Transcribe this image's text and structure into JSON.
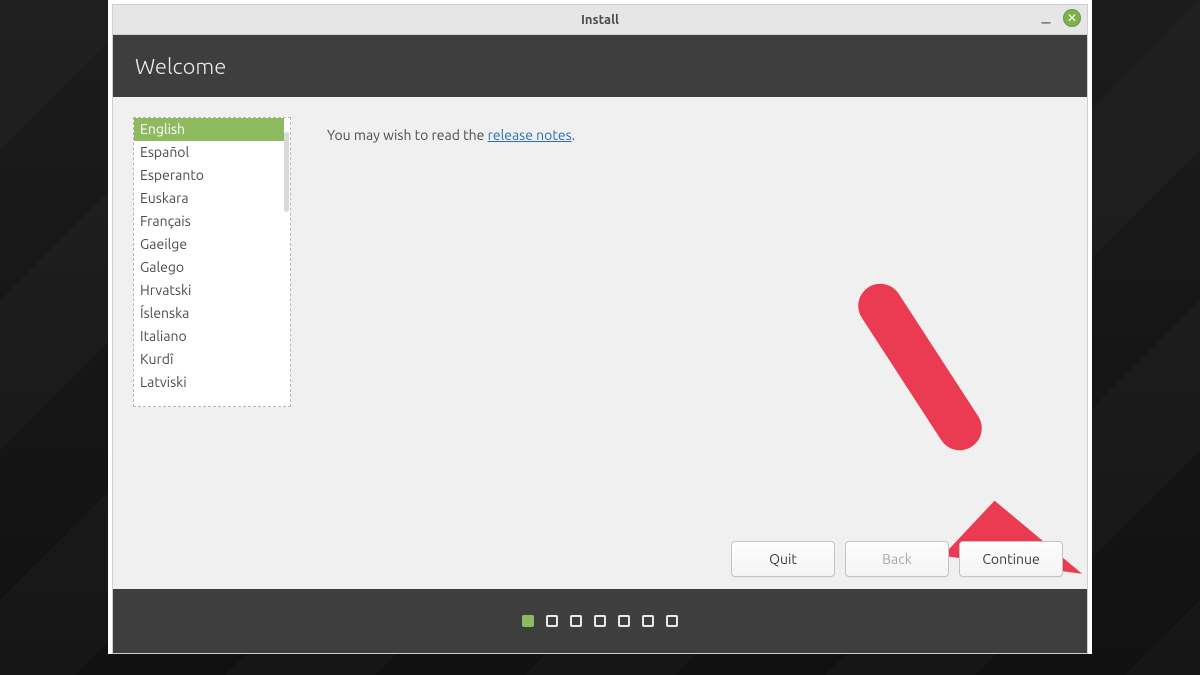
{
  "window": {
    "title": "Install"
  },
  "header": {
    "title": "Welcome"
  },
  "languages": {
    "selected_index": 0,
    "items": [
      "English",
      "Español",
      "Esperanto",
      "Euskara",
      "Français",
      "Gaeilge",
      "Galego",
      "Hrvatski",
      "Íslenska",
      "Italiano",
      "Kurdî",
      "Latviski"
    ]
  },
  "release": {
    "prefix": "You may wish to read the ",
    "link_text": "release notes",
    "suffix": "."
  },
  "buttons": {
    "quit": "Quit",
    "back": "Back",
    "continue": "Continue"
  },
  "progress": {
    "total_steps": 7,
    "current_step": 1
  },
  "colors": {
    "accent": "#8fbb60",
    "header_bg": "#3e3e3e",
    "link": "#2a6fb3"
  }
}
